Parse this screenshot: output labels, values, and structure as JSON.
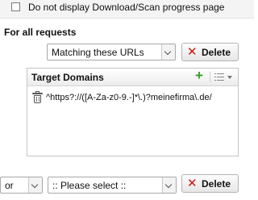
{
  "top_option": {
    "label": "Do not display Download/Scan progress page",
    "checked": false
  },
  "section": {
    "title": "For all requests"
  },
  "row1": {
    "select_value": "Matching these URLs",
    "delete_label": "Delete"
  },
  "panel": {
    "title": "Target Domains",
    "items": [
      {
        "value": "^https?://([A-Za-z0-9.-]*\\.)?meinefirma\\.de/"
      }
    ]
  },
  "row2": {
    "operator_value": "or",
    "select_value": ":: Please select ::",
    "delete_label": "Delete"
  }
}
